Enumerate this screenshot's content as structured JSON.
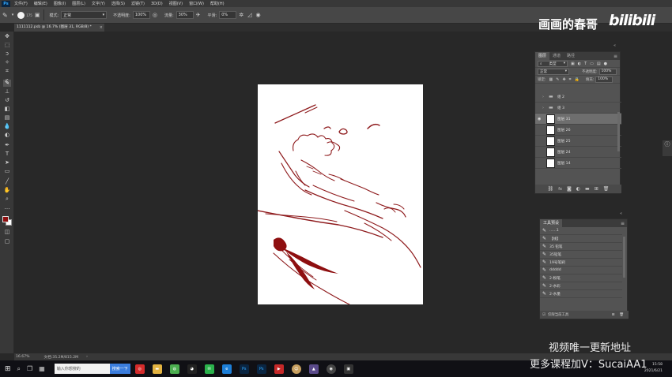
{
  "app": {
    "logo": "Ps"
  },
  "menu": [
    "文件(F)",
    "编辑(E)",
    "图像(I)",
    "图层(L)",
    "文字(Y)",
    "选择(S)",
    "滤镜(T)",
    "3D(D)",
    "视图(V)",
    "窗口(W)",
    "帮助(H)"
  ],
  "options": {
    "brush_size": "175",
    "mode_label": "模式:",
    "mode_value": "正常",
    "opacity_label": "不透明度:",
    "opacity_value": "100%",
    "flow_label": "流量:",
    "flow_value": "30%",
    "smoothing_label": "平滑:",
    "smoothing_value": "0%"
  },
  "document": {
    "tab_title": "1111112.psb @ 16.7% (图层 31, RGB/8) *",
    "close": "×"
  },
  "statusbar": {
    "zoom": "16.67%",
    "doc_info": "文档:35.2M/815.2M",
    "arrow": "›"
  },
  "layers_panel": {
    "tabs": [
      "图层",
      "通道",
      "路径"
    ],
    "filter_label": "类型",
    "blend_mode": "正常",
    "opacity_label": "不透明度:",
    "opacity_value": "100%",
    "lock_label": "锁定:",
    "fill_label": "填充:",
    "fill_value": "100%",
    "layers": [
      {
        "name": "组 2",
        "kind": "group",
        "visible": false
      },
      {
        "name": "组 3",
        "kind": "group",
        "visible": false
      },
      {
        "name": "图层 31",
        "kind": "layer",
        "visible": true,
        "selected": true
      },
      {
        "name": "图层 26",
        "kind": "layer",
        "visible": false
      },
      {
        "name": "图层 25",
        "kind": "layer",
        "visible": false
      },
      {
        "name": "图层 24",
        "kind": "layer",
        "visible": false
      },
      {
        "name": "图层 14",
        "kind": "layer",
        "visible": false
      }
    ]
  },
  "presets_panel": {
    "title": "工具预设",
    "items": [
      "......1",
      "【线】",
      "35 铅笔",
      "35铅笔",
      "19号笔刷",
      "ddddd",
      "2-粉笔",
      "2-水彩",
      "2-水墨"
    ],
    "footer": "仅限当前工具"
  },
  "taskbar": {
    "search_placeholder": "输入你想搜的",
    "search_button": "搜索一下",
    "time": "15:58",
    "date": "2021/6/21"
  },
  "watermark": {
    "title": "画画的春哥",
    "brand": "bilibili",
    "line1": "视频唯一更新地址",
    "line2": "更多课程加V：SucaiAA1"
  },
  "colors": {
    "foreground": "#8e0f10",
    "background": "#ffffff"
  },
  "icons": [
    "photoshop-logo",
    "brush-icon",
    "eye-icon",
    "folder-icon",
    "windows-start-icon",
    "search-icon"
  ]
}
